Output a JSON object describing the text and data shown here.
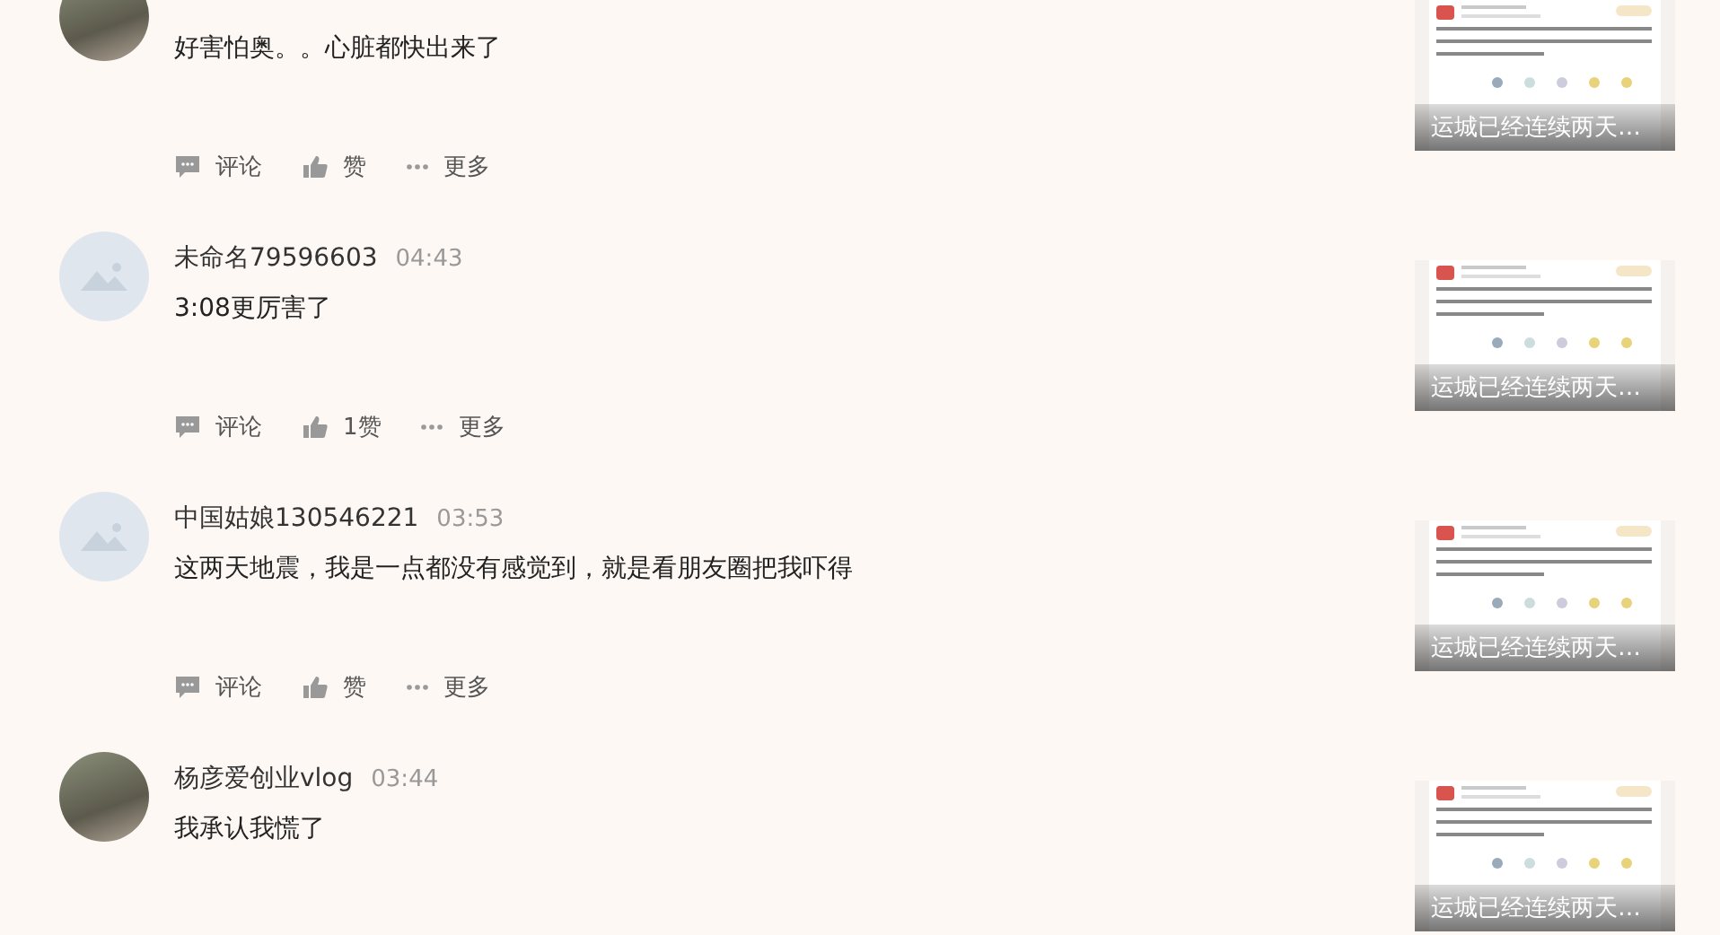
{
  "comments": [
    {
      "avatar": {
        "kind": "photo"
      },
      "text": "好害怕奥。。心脏都快出来了",
      "actions": [
        {
          "kind": "comment",
          "label": "评论"
        },
        {
          "kind": "like",
          "label": "赞"
        },
        {
          "kind": "more",
          "label": "更多"
        }
      ],
      "video": {
        "caption": "运城已经连续两天…"
      }
    },
    {
      "avatar": {
        "kind": "default"
      },
      "name": "未命名79596603",
      "time": "04:43",
      "text": "3:08更厉害了",
      "actions": [
        {
          "kind": "comment",
          "label": "评论"
        },
        {
          "kind": "like",
          "label": "1赞"
        },
        {
          "kind": "more",
          "label": "更多"
        }
      ],
      "video": {
        "caption": "运城已经连续两天…"
      }
    },
    {
      "avatar": {
        "kind": "default"
      },
      "name": "中国姑娘130546221",
      "time": "03:53",
      "text": "这两天地震，我是一点都没有感觉到，就是看朋友圈把我吓得",
      "actions": [
        {
          "kind": "comment",
          "label": "评论"
        },
        {
          "kind": "like",
          "label": "赞"
        },
        {
          "kind": "more",
          "label": "更多"
        }
      ],
      "video": {
        "caption": "运城已经连续两天…"
      }
    },
    {
      "avatar": {
        "kind": "photo"
      },
      "name": "杨彦爱创业vlog",
      "time": "03:44",
      "text": "我承认我慌了",
      "video": {
        "caption": "运城已经连续两天…"
      }
    }
  ]
}
